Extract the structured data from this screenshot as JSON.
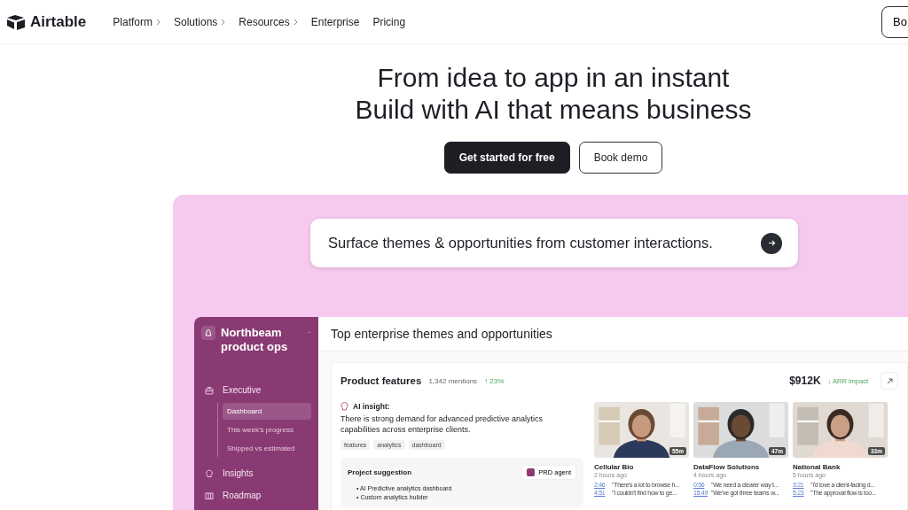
{
  "nav": {
    "logo": "Airtable",
    "items": [
      {
        "label": "Platform",
        "has_caret": true
      },
      {
        "label": "Solutions",
        "has_caret": true
      },
      {
        "label": "Resources",
        "has_caret": true
      },
      {
        "label": "Enterprise",
        "has_caret": false
      },
      {
        "label": "Pricing",
        "has_caret": false
      }
    ],
    "cta": "Bo"
  },
  "hero": {
    "lines": [
      "From idea to app in an instant",
      "Build with AI that means business"
    ],
    "buttons": [
      {
        "label": "Get started for free",
        "kind": "primary"
      },
      {
        "label": "Book demo",
        "kind": "secondary"
      }
    ]
  },
  "prompt": {
    "text": "Surface themes & opportunities from customer interactions."
  },
  "app": {
    "workspace": "Northbeam product ops",
    "sidebar": [
      {
        "label": "Executive",
        "children": [
          {
            "label": "Dashboard",
            "selected": true
          },
          {
            "label": "This week's progress",
            "selected": false
          },
          {
            "label": "Shipped vs estimated",
            "selected": false
          }
        ]
      },
      {
        "label": "Insights"
      },
      {
        "label": "Roadmap"
      }
    ],
    "title": "Top enterprise themes and opportunities",
    "card": {
      "title": "Product features",
      "mentions": "1,342 mentions",
      "change": "↑ 23%",
      "amount": "$912K",
      "impact": "↓ ARR impact",
      "insight_label": "AI insight:",
      "insight": "There is strong demand for advanced predictive analytics capabilities across enterprise clients.",
      "tags": [
        "features",
        "analytics",
        "dashboard"
      ],
      "suggestion": {
        "title": "Project suggestion",
        "agent": "PRD agent",
        "bullets": [
          "• AI Predictive analytics dashboard",
          "• Custom analytics builder"
        ]
      },
      "calls": [
        {
          "name": "Cellular Bio",
          "ago": "2 hours ago",
          "duration": "55m",
          "quotes": [
            {
              "time": "2:46",
              "text": "\"There's a lot to browse h..."
            },
            {
              "time": "4:51",
              "text": "\"I couldn't find how to ge..."
            }
          ]
        },
        {
          "name": "DataFlow Solutions",
          "ago": "4 hours ago",
          "duration": "47m",
          "quotes": [
            {
              "time": "0:56",
              "text": "\"We need a clearer way t..."
            },
            {
              "time": "15:49",
              "text": "\"We've got three teams w..."
            }
          ]
        },
        {
          "name": "National Bank",
          "ago": "5 hours ago",
          "duration": "33m",
          "quotes": [
            {
              "time": "3:21",
              "text": "\"I'd love a client-facing d..."
            },
            {
              "time": "5:23",
              "text": "\"The approval flow is too..."
            }
          ]
        }
      ]
    }
  }
}
